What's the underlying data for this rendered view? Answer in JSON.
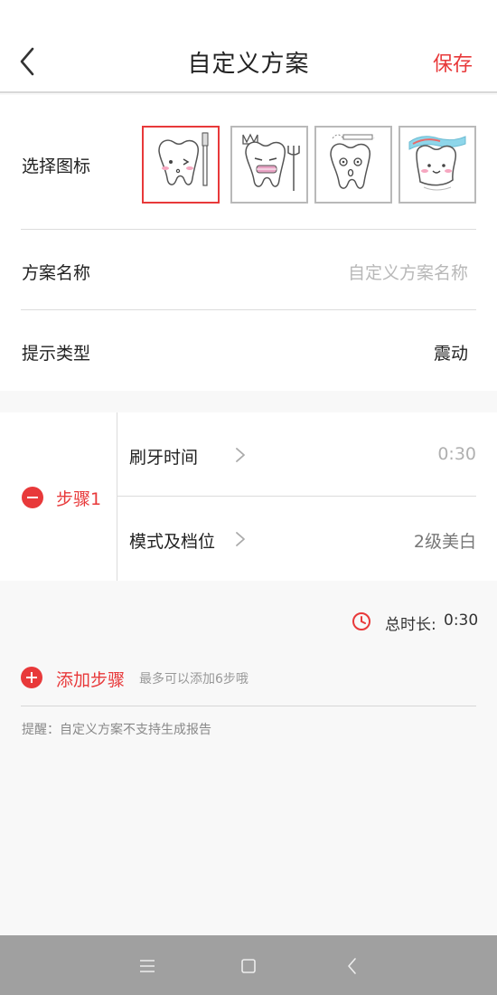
{
  "header": {
    "title": "自定义方案",
    "save_label": "保存",
    "back_icon": "chevron-left-icon"
  },
  "icon_picker": {
    "label": "选择图标",
    "icons": [
      {
        "name": "tooth-with-brush-icon",
        "selected": true
      },
      {
        "name": "tooth-with-crown-trident-icon",
        "selected": false
      },
      {
        "name": "tooth-surprised-icon",
        "selected": false
      },
      {
        "name": "tooth-with-toothpaste-icon",
        "selected": false
      }
    ]
  },
  "plan_name": {
    "label": "方案名称",
    "placeholder": "自定义方案名称"
  },
  "prompt_type": {
    "label": "提示类型",
    "value": "震动"
  },
  "steps": [
    {
      "label": "步骤1",
      "brush_time_label": "刷牙时间",
      "brush_time_value": "0:30",
      "mode_label": "模式及档位",
      "mode_value": "2级美白"
    }
  ],
  "total": {
    "label": "总时长:",
    "value": "0:30"
  },
  "add_step": {
    "label": "添加步骤",
    "hint": "最多可以添加6步哦"
  },
  "reminder": "提醒：自定义方案不支持生成报告",
  "colors": {
    "accent": "#e8393a",
    "divider": "#dcdcdc",
    "navbar": "#a0a0a0"
  }
}
